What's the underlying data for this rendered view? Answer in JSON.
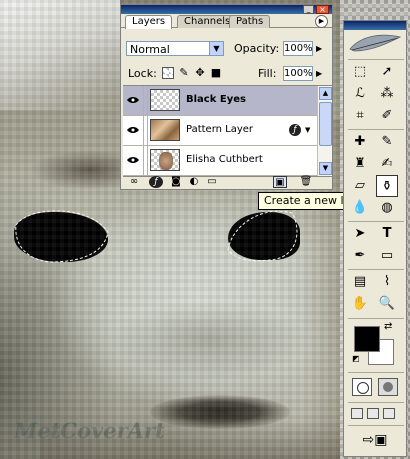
{
  "watermark": "MetCoverArt",
  "layers_panel": {
    "tabs": [
      "Layers",
      "Channels",
      "Paths"
    ],
    "blend_mode": "Normal",
    "opacity_label": "Opacity:",
    "opacity_value": "100%",
    "lock_label": "Lock:",
    "fill_label": "Fill:",
    "fill_value": "100%",
    "layers": [
      {
        "name": "Black Eyes",
        "active": true
      },
      {
        "name": "Pattern Layer",
        "active": false
      },
      {
        "name": "Elisha Cuthbert",
        "active": false
      }
    ]
  },
  "tooltip": "Create a new layer",
  "icons": {
    "panel_close": "close-icon",
    "panel_minimize": "minimize-icon",
    "palette_menu": "palette-menu-icon",
    "visibility": "eye-icon",
    "fx": "fx-icon",
    "new_layer": "new-layer-icon",
    "trash": "trash-icon"
  },
  "colors": {
    "foreground": "#000000",
    "background": "#ffffff",
    "selected_layer": "#b5b6c9"
  }
}
